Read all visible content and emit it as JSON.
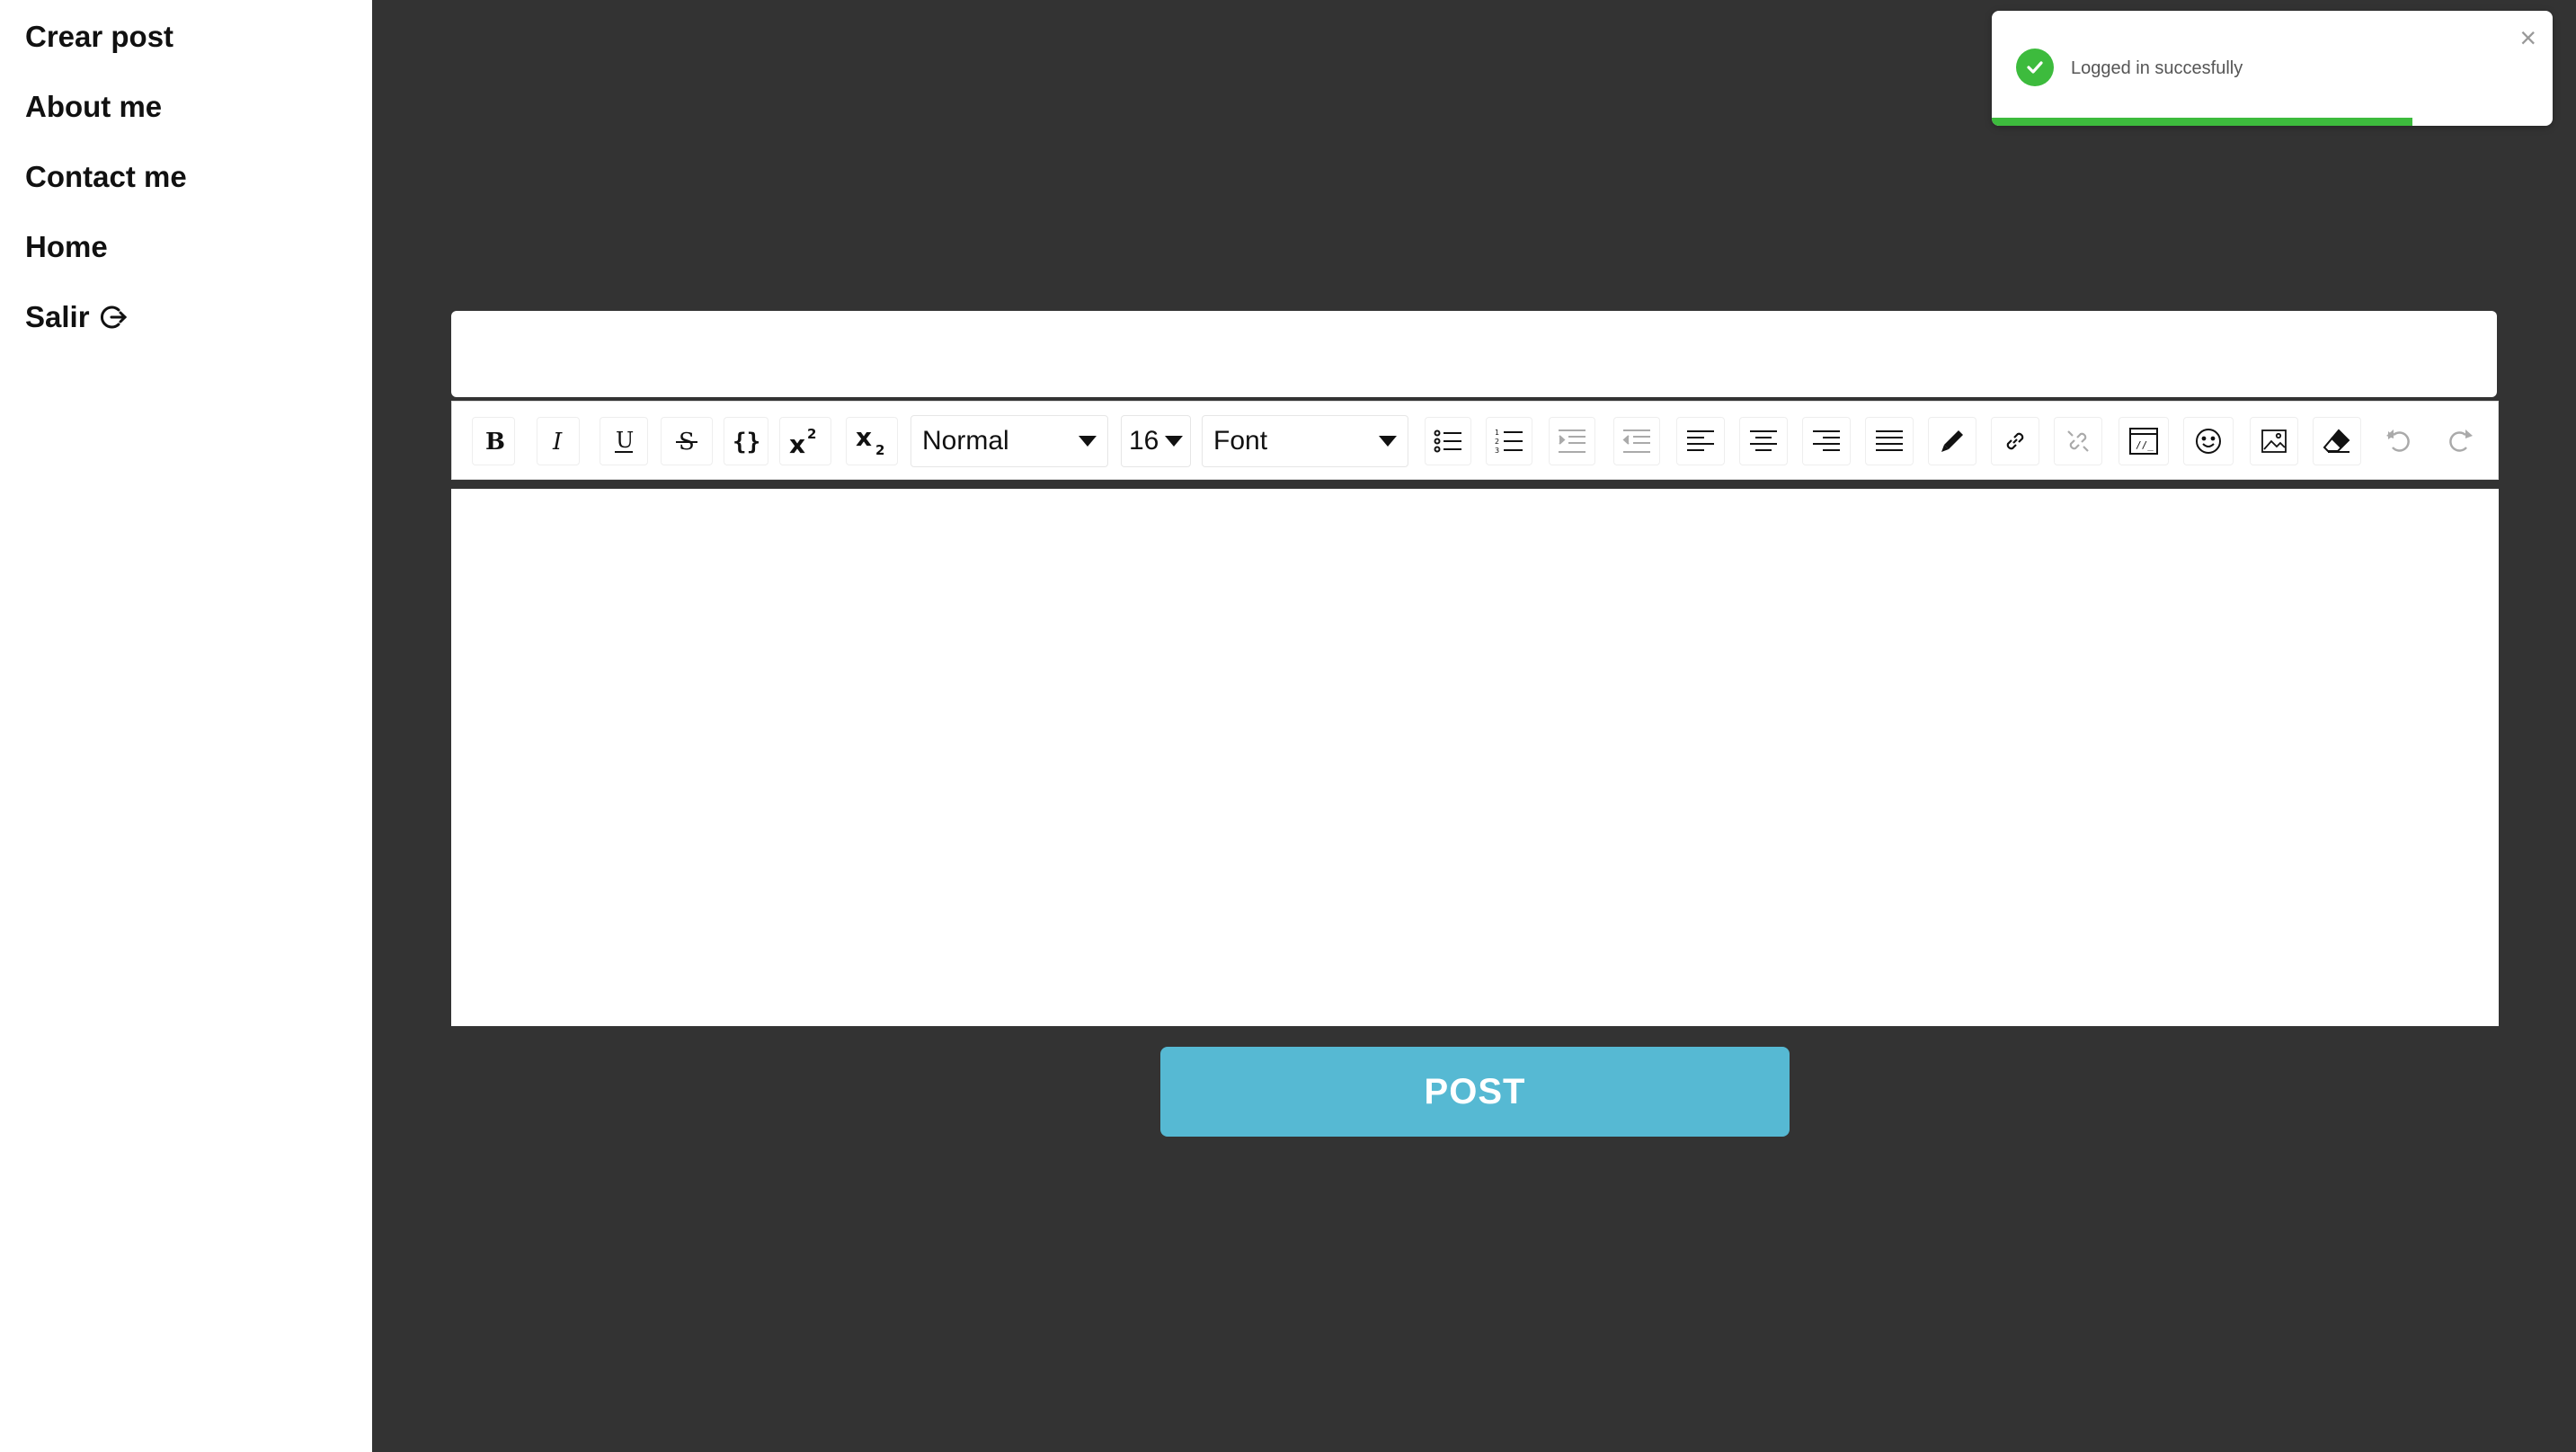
{
  "sidebar": {
    "items": [
      {
        "label": "Crear post"
      },
      {
        "label": "About me"
      },
      {
        "label": "Contact me"
      },
      {
        "label": "Home"
      },
      {
        "label": "Salir",
        "icon": "logout-icon"
      }
    ]
  },
  "editor": {
    "title_value": "",
    "body_value": "",
    "toolbar": {
      "heading": "Normal",
      "font_size": "16",
      "font": "Font",
      "buttons": [
        "bold",
        "italic",
        "underline",
        "strikethrough",
        "code",
        "superscript",
        "subscript",
        "unordered-list",
        "ordered-list",
        "indent",
        "outdent",
        "align-left",
        "align-center",
        "align-right",
        "align-justify",
        "color-picker",
        "link",
        "unlink",
        "embed",
        "emoji",
        "image",
        "remove-format",
        "undo",
        "redo"
      ]
    }
  },
  "post_button": {
    "label": "POST",
    "color": "#56b9d3"
  },
  "toast": {
    "message": "Logged in succesfully",
    "close": "×",
    "progress": 0.75,
    "color": "#3dbb3d"
  },
  "colors": {
    "background": "#333333",
    "sidebar": "#ffffff"
  }
}
